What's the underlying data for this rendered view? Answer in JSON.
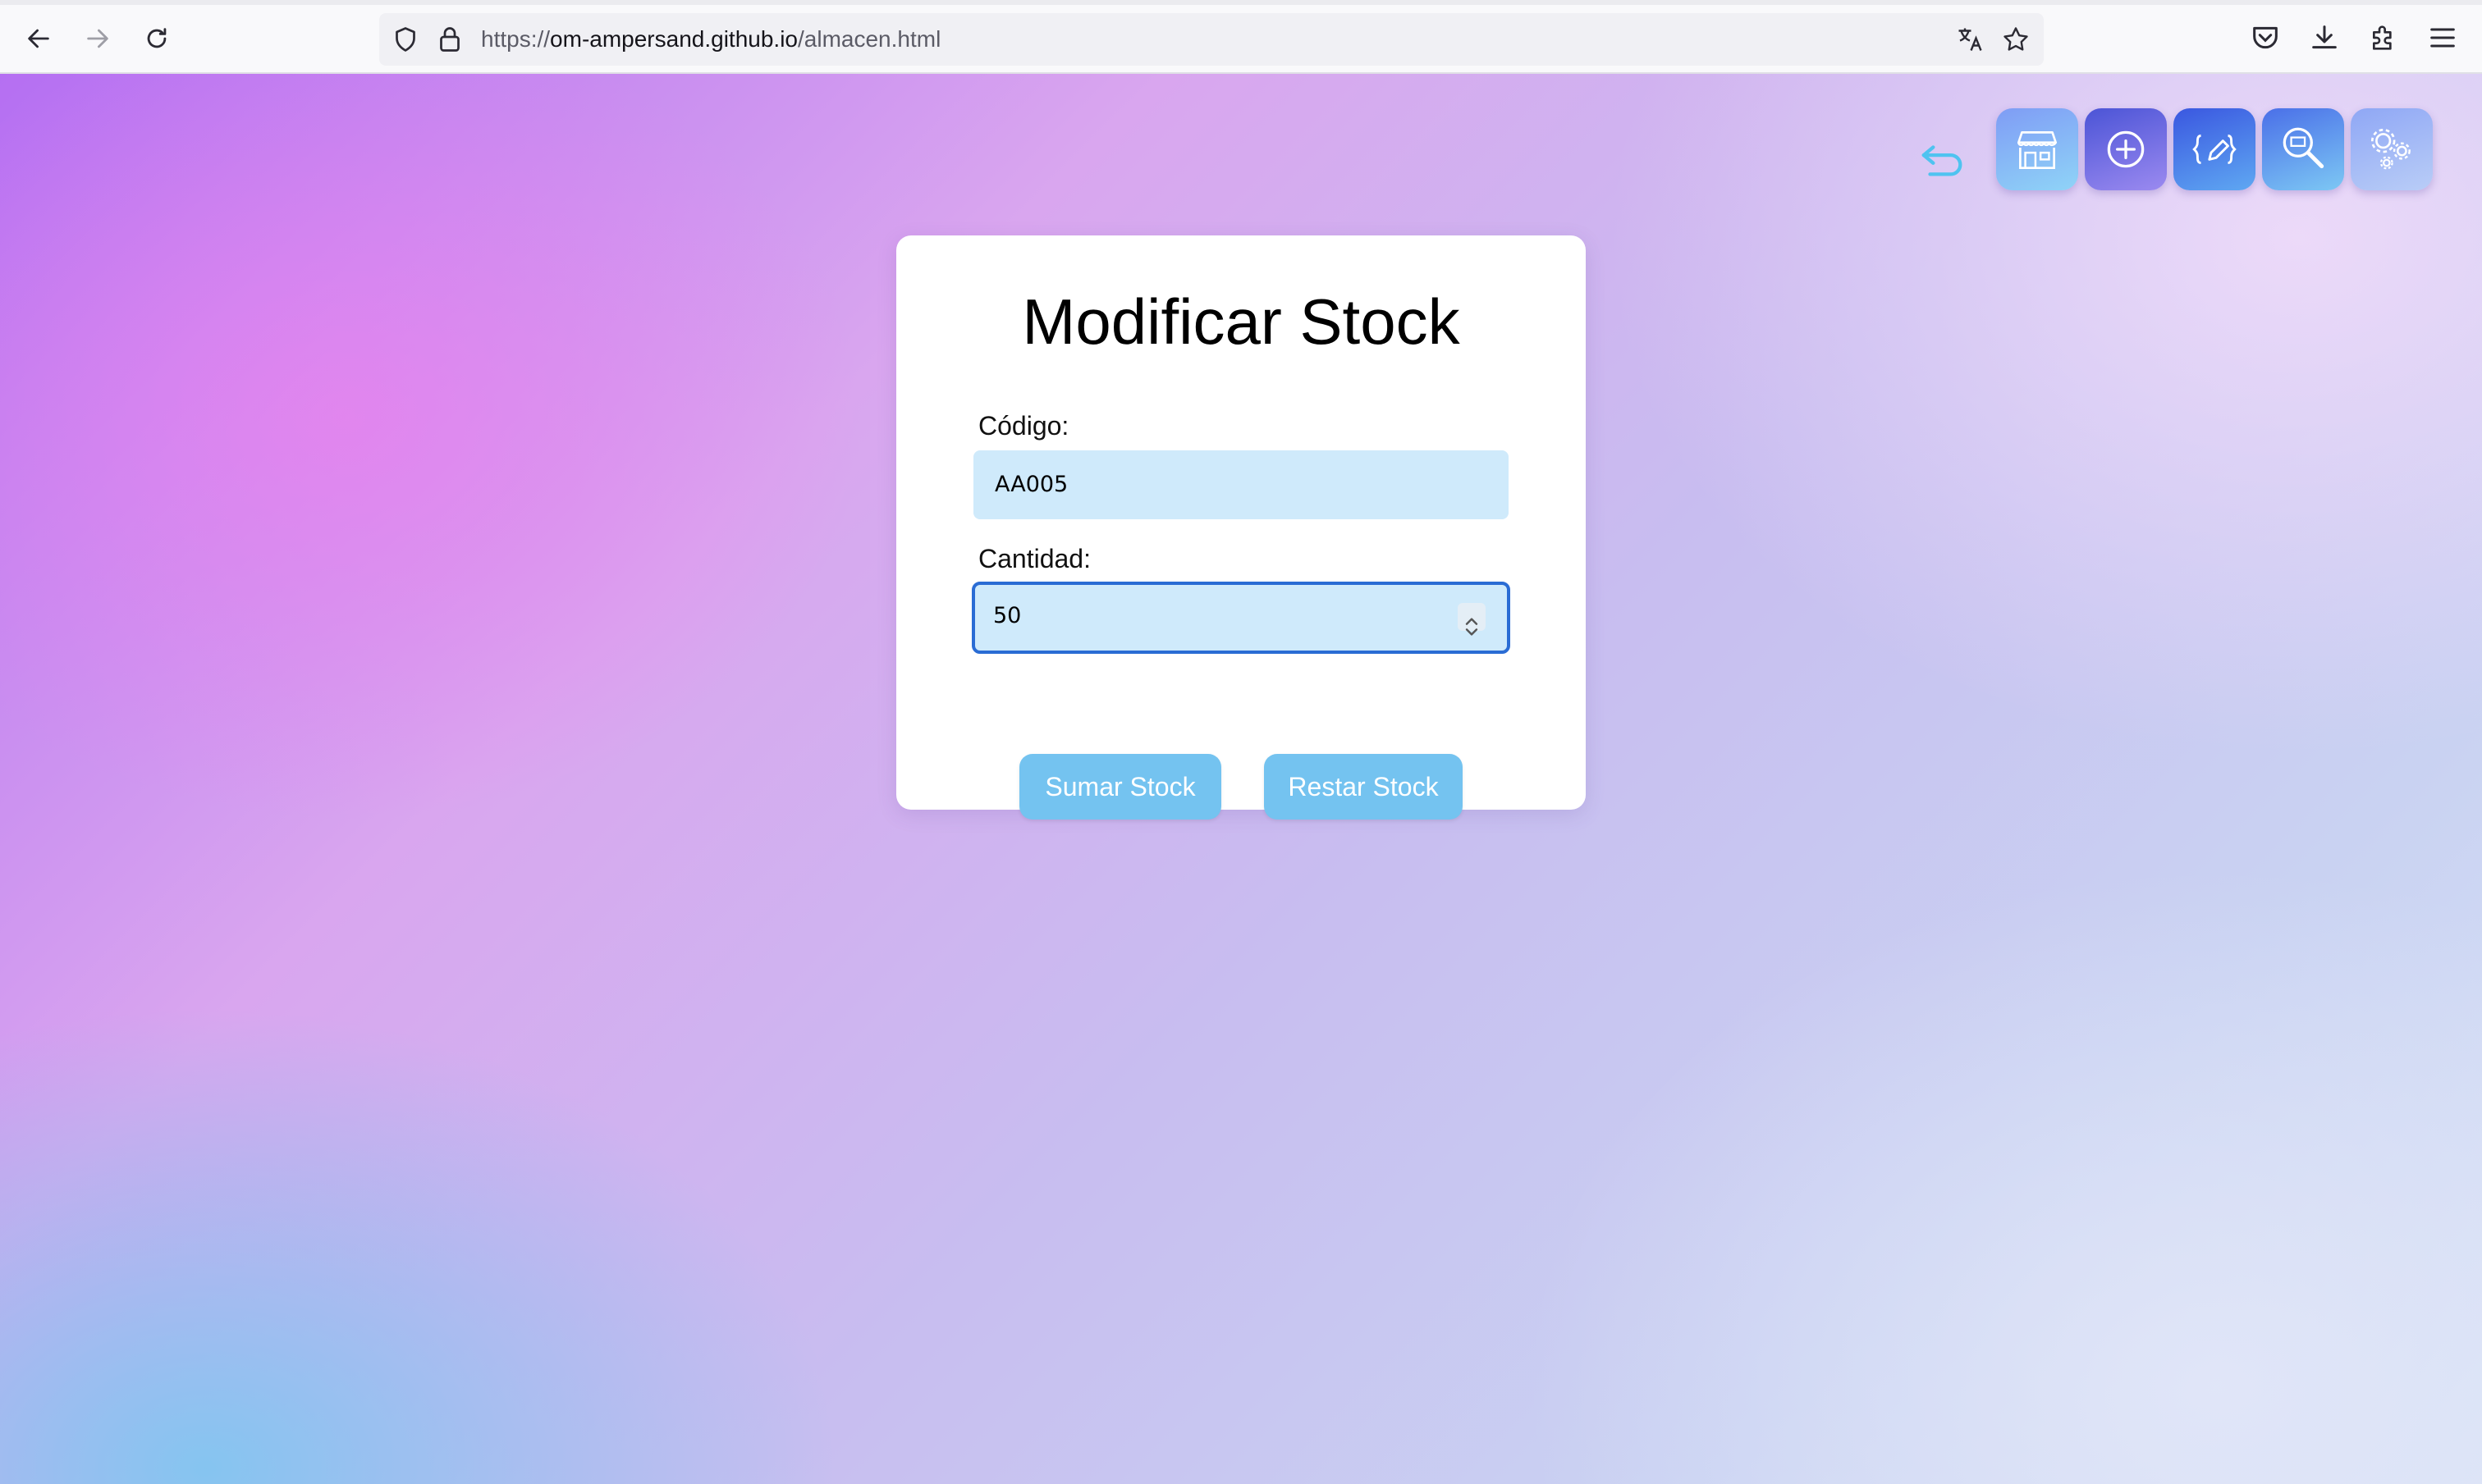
{
  "browser": {
    "url_scheme": "https://",
    "url_host": "om-ampersand.github.io",
    "url_path": "/almacen.html"
  },
  "nav_icons": [
    "back-arrow-icon",
    "store-icon",
    "add-icon",
    "edit-icon",
    "search-icon",
    "settings-icon"
  ],
  "form": {
    "title": "Modificar Stock",
    "code_label": "Código:",
    "code_value": "AA005",
    "quantity_label": "Cantidad:",
    "quantity_value": "50",
    "add_button": "Sumar Stock",
    "subtract_button": "Restar Stock"
  },
  "colors": {
    "button": "#74c3f0",
    "input_bg": "#cfeafb",
    "focus_border": "#2a6cd4"
  }
}
